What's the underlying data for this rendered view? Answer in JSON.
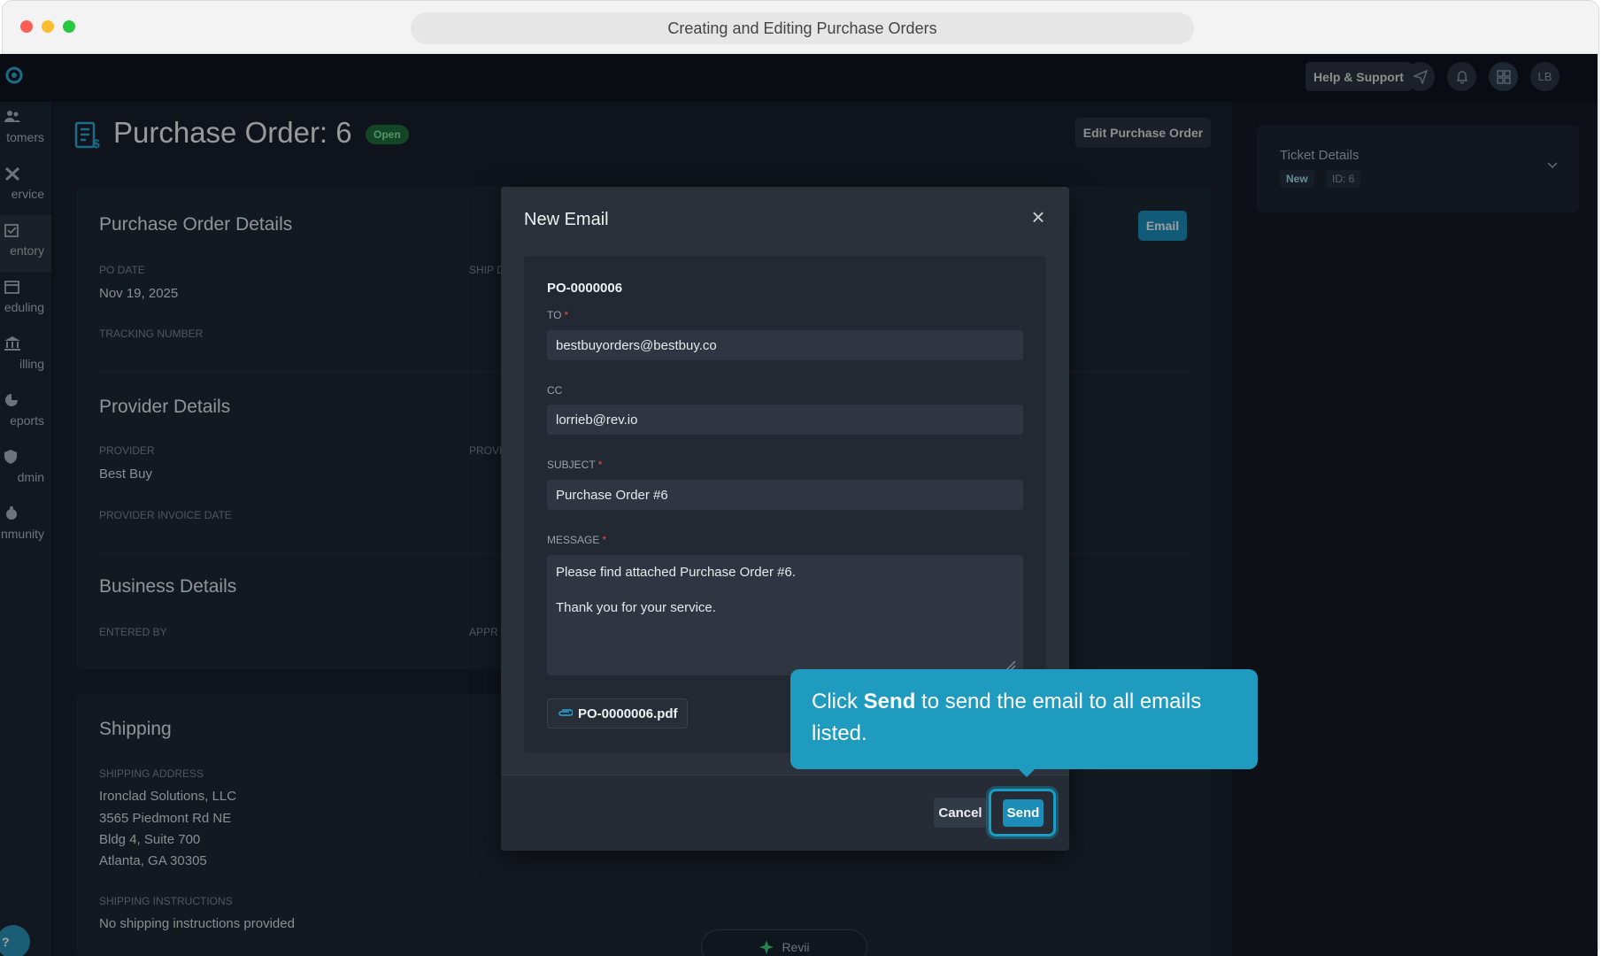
{
  "browser": {
    "title": "Creating and Editing Purchase Orders"
  },
  "topbar": {
    "help_label": "Help & Support",
    "avatar_initials": "LB"
  },
  "sidebar": {
    "items": [
      {
        "label": "tomers",
        "icon": "users-icon"
      },
      {
        "label": "ervice",
        "icon": "tools-icon"
      },
      {
        "label": "entory",
        "icon": "inventory-icon"
      },
      {
        "label": "eduling",
        "icon": "calendar-icon"
      },
      {
        "label": "illing",
        "icon": "bank-icon"
      },
      {
        "label": "eports",
        "icon": "pie-chart-icon"
      },
      {
        "label": "dmin",
        "icon": "admin-shield-icon"
      },
      {
        "label": "nmunity",
        "icon": "community-icon"
      }
    ],
    "help_fab": "?"
  },
  "page": {
    "title": "Purchase Order: 6",
    "status": "Open",
    "edit_button": "Edit Purchase Order",
    "email_button": "Email"
  },
  "po_details": {
    "title": "Purchase Order Details",
    "po_date_label": "PO DATE",
    "po_date": "Nov 19, 2025",
    "ship_label": "SHIP D",
    "tracking_label": "TRACKING NUMBER"
  },
  "provider_details": {
    "title": "Provider Details",
    "provider_label": "PROVIDER",
    "provider": "Best Buy",
    "prov_label": "PROVI",
    "invoice_date_label": "PROVIDER INVOICE DATE"
  },
  "business_details": {
    "title": "Business Details",
    "entered_by_label": "ENTERED BY",
    "appr_label": "APPR"
  },
  "shipping": {
    "title": "Shipping",
    "address_label": "SHIPPING ADDRESS",
    "address_lines": [
      "Ironclad Solutions, LLC",
      "3565 Piedmont Rd NE",
      "Bldg 4, Suite 700",
      "Atlanta, GA 30305"
    ],
    "instructions_label": "SHIPPING INSTRUCTIONS",
    "instructions": "No shipping instructions provided"
  },
  "ticket": {
    "title": "Ticket Details",
    "status": "New",
    "id": "ID: 6"
  },
  "revii": {
    "label": "Revii"
  },
  "email_modal": {
    "title": "New Email",
    "po_number": "PO-0000006",
    "to_label": "TO",
    "to_value": "bestbuyorders@bestbuy.co",
    "cc_label": "CC",
    "cc_value": "lorrieb@rev.io",
    "subject_label": "SUBJECT",
    "subject_value": "Purchase Order #6",
    "message_label": "MESSAGE",
    "message_line1": "Please find attached Purchase Order #6.",
    "message_line2": "Thank you for your service.",
    "attachment": "PO-0000006.pdf",
    "cancel_label": "Cancel",
    "send_label": "Send"
  },
  "tooltip": {
    "pre": "Click ",
    "bold": "Send",
    "post": " to send the email to all emails listed."
  },
  "colors": {
    "accent": "#1b8db8",
    "tooltip": "#1f9bbf",
    "background": "#141c26",
    "required": "#e0524f",
    "open_badge": "#1f6b3a"
  }
}
